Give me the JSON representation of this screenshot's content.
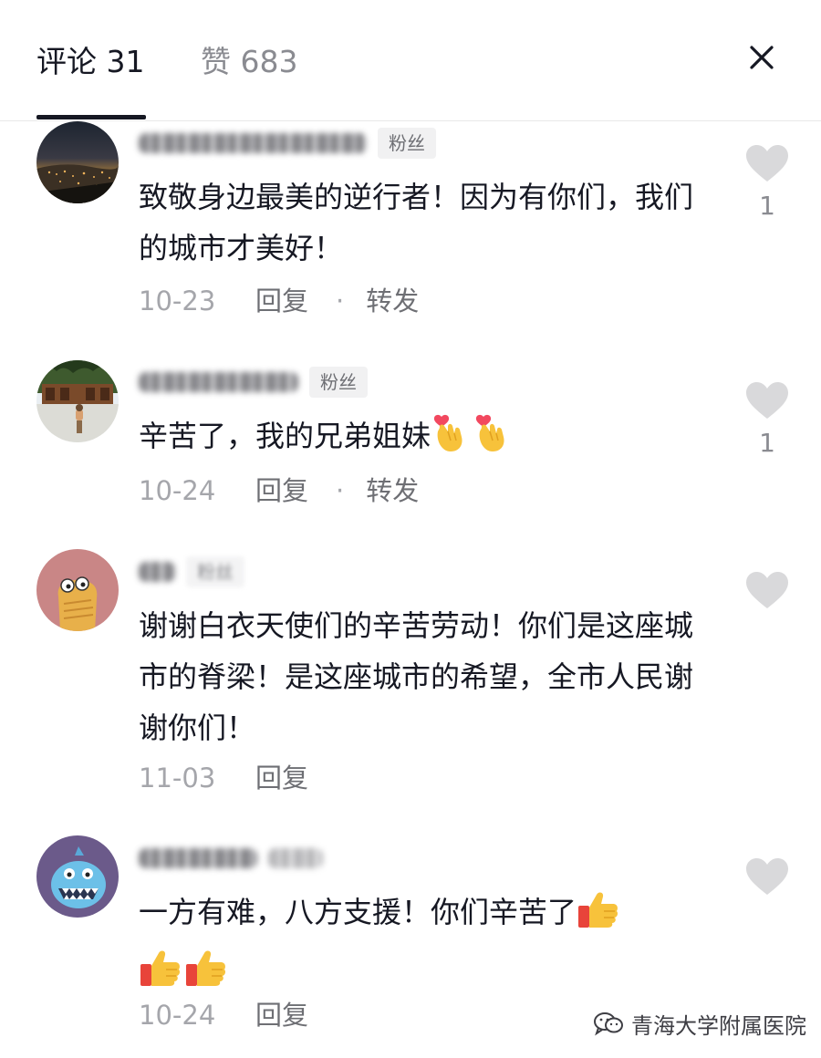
{
  "header": {
    "comments_tab": "评论 31",
    "likes_tab": "赞 683",
    "close_icon": "close-icon"
  },
  "comments": [
    {
      "badge": "粉丝",
      "text": "致敬身边最美的逆行者！因为有你们，我们的城市才美好！",
      "date": "10-23",
      "reply": "回复",
      "separator": "·",
      "share": "转发",
      "likes": "1"
    },
    {
      "badge": "粉丝",
      "text": "辛苦了，我的兄弟姐妹",
      "emojis": [
        "finger-heart",
        "finger-heart"
      ],
      "date": "10-24",
      "reply": "回复",
      "separator": "·",
      "share": "转发",
      "likes": "1"
    },
    {
      "badge": "粉丝",
      "text": "谢谢白衣天使们的辛苦劳动！你们是这座城市的脊梁！是这座城市的希望，全市人民谢谢你们！",
      "date": "11-03",
      "reply": "回复"
    },
    {
      "text": "一方有难，八方支援！你们辛苦了",
      "emojis": [
        "thumbs-up",
        "thumbs-up",
        "thumbs-up"
      ],
      "date": "10-24",
      "reply": "回复"
    }
  ],
  "watermark": "青海大学附属医院",
  "colors": {
    "primary_text": "#161823",
    "secondary_text": "#8a8b91",
    "heart": "#d9d9db",
    "badge_bg": "#f1f1f2"
  }
}
